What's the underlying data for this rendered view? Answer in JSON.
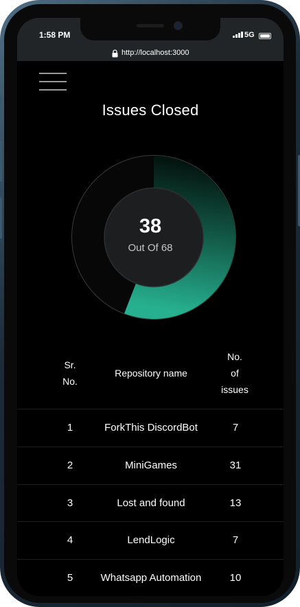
{
  "status_bar": {
    "time": "1:58 PM",
    "network": "5G"
  },
  "browser": {
    "url": "http://localhost:3000"
  },
  "page": {
    "title": "Issues Closed"
  },
  "progress": {
    "closed": 38,
    "closed_label": "38",
    "total": 68,
    "subtitle": "Out Of 68"
  },
  "colors": {
    "accent_start": "#0b2a22",
    "accent_end": "#23a888",
    "background": "#000000"
  },
  "table": {
    "headers": {
      "sr": [
        "Sr.",
        "No."
      ],
      "name": [
        "Repository name"
      ],
      "issues": [
        "No.",
        "of",
        "issues"
      ]
    },
    "rows": [
      {
        "sr": "1",
        "name": "ForkThis DiscordBot",
        "issues": "7"
      },
      {
        "sr": "2",
        "name": "MiniGames",
        "issues": "31"
      },
      {
        "sr": "3",
        "name": "Lost and found",
        "issues": "13"
      },
      {
        "sr": "4",
        "name": "LendLogic",
        "issues": "7"
      },
      {
        "sr": "5",
        "name": "Whatsapp Automation",
        "issues": "10"
      }
    ]
  }
}
